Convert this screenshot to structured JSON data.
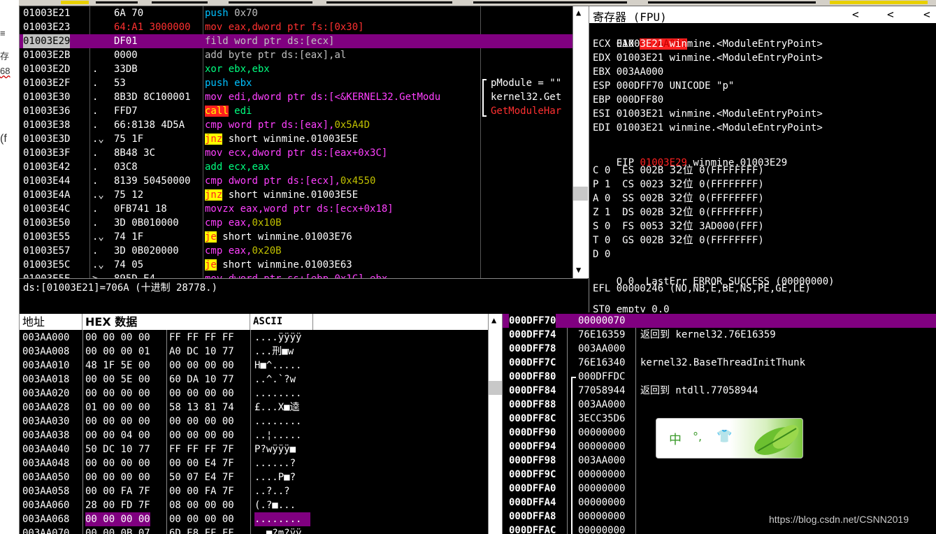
{
  "left_strip": {
    "chars": [
      "≡",
      "存",
      "68",
      "(f"
    ]
  },
  "disasm": {
    "rows": [
      {
        "addr": "01003E21",
        "mark": "",
        "hex": "6A 70",
        "mn": "push",
        "mn_class": "kw-push",
        "ops": " 0x70",
        "ops_class": "op-gray",
        "gray_line": true
      },
      {
        "addr": "01003E23",
        "mark": "",
        "hex": "64:A1 3000000",
        "mn": "mov",
        "mn_class": "op-red",
        "ops": " eax,dword ptr fs:[0x30]",
        "ops_class": "op-red",
        "hex_red": true
      },
      {
        "addr": "01003E29",
        "mark": "",
        "hex": "DF01",
        "mn": "fild",
        "mn_class": "op-gray",
        "ops": " word ptr ds:[ecx]",
        "ops_class": "op-gray",
        "selected": true
      },
      {
        "addr": "01003E2B",
        "mark": "",
        "hex": "0000",
        "mn": "add",
        "mn_class": "op-gray",
        "ops": " byte ptr ds:[eax],al",
        "ops_class": "op-gray"
      },
      {
        "addr": "01003E2D",
        "mark": ".",
        "hex": "33DB",
        "mn": "xor",
        "mn_class": "kw-xor",
        "ops": " ebx,ebx",
        "ops_class": "kw-xor"
      },
      {
        "addr": "01003E2F",
        "mark": ".",
        "hex": "53",
        "mn": "push",
        "mn_class": "kw-push",
        "ops": " ebx",
        "ops_class": "kw-push"
      },
      {
        "addr": "01003E30",
        "mark": ".",
        "hex": "8B3D 8C100001",
        "mn": "mov",
        "mn_class": "kw-mov",
        "ops": " edi,dword ptr ds:[<&KERNEL32.GetModu",
        "ops_class": "kw-mov"
      },
      {
        "addr": "01003E36",
        "mark": ".",
        "hex": "FFD7",
        "mn": "call",
        "mn_class": "kw-call",
        "ops": " edi",
        "ops_class": "kw-xor"
      },
      {
        "addr": "01003E38",
        "mark": ".",
        "hex": "66:8138 4D5A",
        "mn": "cmp",
        "mn_class": "kw-cmp",
        "ops": " word ptr ds:[eax],",
        "ops_class": "kw-cmp",
        "ops2": "0x5A4D",
        "ops2_class": "op-num"
      },
      {
        "addr": "01003E3D",
        "mark": ".⌄",
        "hex": "75 1F",
        "mn": "jnz",
        "mn_class": "kw-jmp",
        "ops": " short winmine.01003E5E",
        "ops_class": "op-white"
      },
      {
        "addr": "01003E3F",
        "mark": ".",
        "hex": "8B48 3C",
        "mn": "mov",
        "mn_class": "kw-mov",
        "ops": " ecx,dword ptr ds:[eax+0x3C]",
        "ops_class": "kw-mov"
      },
      {
        "addr": "01003E42",
        "mark": ".",
        "hex": "03C8",
        "mn": "add",
        "mn_class": "kw-add",
        "ops": " ecx,eax",
        "ops_class": "kw-add"
      },
      {
        "addr": "01003E44",
        "mark": ".",
        "hex": "8139 50450000",
        "mn": "cmp",
        "mn_class": "kw-cmp",
        "ops": " dword ptr ds:[ecx],",
        "ops_class": "kw-cmp",
        "ops2": "0x4550",
        "ops2_class": "op-num"
      },
      {
        "addr": "01003E4A",
        "mark": ".⌄",
        "hex": "75 12",
        "mn": "jnz",
        "mn_class": "kw-jmp",
        "ops": " short winmine.01003E5E",
        "ops_class": "op-white"
      },
      {
        "addr": "01003E4C",
        "mark": ".",
        "hex": "0FB741 18",
        "mn": "movzx",
        "mn_class": "kw-mov",
        "ops": " eax,word ptr ds:[ecx+0x18]",
        "ops_class": "kw-mov"
      },
      {
        "addr": "01003E50",
        "mark": ".",
        "hex": "3D 0B010000",
        "mn": "cmp",
        "mn_class": "kw-cmp",
        "ops": " eax,",
        "ops_class": "kw-cmp",
        "ops2": "0x10B",
        "ops2_class": "op-num"
      },
      {
        "addr": "01003E55",
        "mark": ".⌄",
        "hex": "74 1F",
        "mn": "je",
        "mn_class": "kw-jmp",
        "ops": " short winmine.01003E76",
        "ops_class": "op-white"
      },
      {
        "addr": "01003E57",
        "mark": ".",
        "hex": "3D 0B020000",
        "mn": "cmp",
        "mn_class": "kw-cmp",
        "ops": " eax,",
        "ops_class": "kw-cmp",
        "ops2": "0x20B",
        "ops2_class": "op-num"
      },
      {
        "addr": "01003E5C",
        "mark": ".⌄",
        "hex": "74 05",
        "mn": "je",
        "mn_class": "kw-jmp",
        "ops": " short winmine.01003E63",
        "ops_class": "op-white"
      },
      {
        "addr": "01003E5E",
        "mark": ">",
        "hex": "895D E4",
        "mn": "mov",
        "mn_class": "kw-mov",
        "ops": " dword ptr ss:[ebp-0x1C],ebx",
        "ops_class": "kw-mov"
      }
    ],
    "comments": [
      {
        "text": "pModule = \"\"",
        "color": "#ffffff"
      },
      {
        "text": "kernel32.Get",
        "color": "#ffffff"
      },
      {
        "text": "GetModuleHar",
        "color": "#ff3030"
      }
    ],
    "info_line": "ds:[01003E21]=706A (十进制 28778.)"
  },
  "registers": {
    "header": "寄存器 (FPU)",
    "header_arrows": [
      "<",
      "<",
      "<"
    ],
    "eax": {
      "name": "EAX",
      "value": "003AA000"
    },
    "gp": [
      {
        "name": "ECX",
        "value": "01003E21",
        "comment": "winmine.<ModuleEntryPoint>"
      },
      {
        "name": "EDX",
        "value": "01003E21",
        "comment": "winmine.<ModuleEntryPoint>"
      },
      {
        "name": "EBX",
        "value": "003AA000",
        "comment": ""
      },
      {
        "name": "ESP",
        "value": "000DFF70",
        "comment": "UNICODE \"p\""
      },
      {
        "name": "EBP",
        "value": "000DFF80",
        "comment": ""
      },
      {
        "name": "ESI",
        "value": "01003E21",
        "comment": "winmine.<ModuleEntryPoint>"
      },
      {
        "name": "EDI",
        "value": "01003E21",
        "comment": "winmine.<ModuleEntryPoint>"
      }
    ],
    "eip": {
      "name": "EIP",
      "value": "01003E29",
      "comment": "winmine.01003E29"
    },
    "flags": [
      {
        "flag": "C 0",
        "seg": "ES 002B",
        "bits": "32位",
        "base": "0(FFFFFFFF)"
      },
      {
        "flag": "P 1",
        "seg": "CS 0023",
        "bits": "32位",
        "base": "0(FFFFFFFF)"
      },
      {
        "flag": "A 0",
        "seg": "SS 002B",
        "bits": "32位",
        "base": "0(FFFFFFFF)"
      },
      {
        "flag": "Z 1",
        "seg": "DS 002B",
        "bits": "32位",
        "base": "0(FFFFFFFF)"
      },
      {
        "flag": "S 0",
        "seg": "FS 0053",
        "bits": "32位",
        "base": "3AD000(FFF)"
      },
      {
        "flag": "T 0",
        "seg": "GS 002B",
        "bits": "32位",
        "base": "0(FFFFFFFF)"
      },
      {
        "flag": "D 0",
        "seg": "",
        "bits": "",
        "base": ""
      }
    ],
    "lasterr": {
      "flag": "O 0",
      "text": "LastErr ERROR_SUCCESS (00000000)"
    },
    "efl": "EFL 00000246 (NO,NB,E,BE,NS,PE,GE,LE)",
    "st0": "ST0 empty 0.0"
  },
  "dump": {
    "headers": [
      "地址",
      "HEX 数据",
      "ASCII"
    ],
    "rows": [
      {
        "addr": "003AA000",
        "hex1": "00 00 00 00",
        "hex2": "FF FF FF FF",
        "ascii": "....ÿÿÿÿ"
      },
      {
        "addr": "003AA008",
        "hex1": "00 00 00 01",
        "hex2": "A0 DC 10 77",
        "ascii": "...刑■w"
      },
      {
        "addr": "003AA010",
        "hex1": "48 1F 5E 00",
        "hex2": "00 00 00 00",
        "ascii": "H■^....."
      },
      {
        "addr": "003AA018",
        "hex1": "00 00 5E 00",
        "hex2": "60 DA 10 77",
        "ascii": "..^.`?w"
      },
      {
        "addr": "003AA020",
        "hex1": "00 00 00 00",
        "hex2": "00 00 00 00",
        "ascii": "........"
      },
      {
        "addr": "003AA028",
        "hex1": "01 00 00 00",
        "hex2": "58 13 81 74",
        "ascii": "£...X■逵"
      },
      {
        "addr": "003AA030",
        "hex1": "00 00 00 00",
        "hex2": "00 00 00 00",
        "ascii": "........"
      },
      {
        "addr": "003AA038",
        "hex1": "00 00 04 00",
        "hex2": "00 00 00 00",
        "ascii": "..¦....."
      },
      {
        "addr": "003AA040",
        "hex1": "50 DC 10 77",
        "hex2": "FF FF FF 7F",
        "ascii": "P?wÿÿÿ■"
      },
      {
        "addr": "003AA048",
        "hex1": "00 00 00 00",
        "hex2": "00 00 E4 7F",
        "ascii": "......?"
      },
      {
        "addr": "003AA050",
        "hex1": "00 00 00 00",
        "hex2": "50 07 E4 7F",
        "ascii": "....P■?"
      },
      {
        "addr": "003AA058",
        "hex1": "00 00 FA 7F",
        "hex2": "00 00 FA 7F",
        "ascii": "..?..?"
      },
      {
        "addr": "003AA060",
        "hex1": "28 00 FD 7F",
        "hex2": "08 00 00 00",
        "ascii": "(.?■..."
      },
      {
        "addr": "003AA068",
        "hex1": "00 00 00 00",
        "hex2": "00 00 00 00",
        "ascii": "........",
        "hl": true
      },
      {
        "addr": "003AA070",
        "hex1": "00 00 0B 07",
        "hex2": "6D E8 FF FF",
        "ascii": "..■?m?ÿÿ"
      }
    ]
  },
  "stack": {
    "rows": [
      {
        "addr": "000DFF70",
        "val": "00000070",
        "comment": "",
        "selected": true
      },
      {
        "addr": "000DFF74",
        "val": "76E16359",
        "comment": "返回到 kernel32.76E16359"
      },
      {
        "addr": "000DFF78",
        "val": "003AA000",
        "comment": ""
      },
      {
        "addr": "000DFF7C",
        "val": "76E16340",
        "comment": "kernel32.BaseThreadInitThunk"
      },
      {
        "addr": "000DFF80",
        "val": "000DFFDC",
        "comment": "",
        "frame_start": true
      },
      {
        "addr": "000DFF84",
        "val": "77058944",
        "comment": "返回到 ntdll.77058944"
      },
      {
        "addr": "000DFF88",
        "val": "003AA000",
        "comment": ""
      },
      {
        "addr": "000DFF8C",
        "val": "3ECC35D6",
        "comment": ""
      },
      {
        "addr": "000DFF90",
        "val": "00000000",
        "comment": ""
      },
      {
        "addr": "000DFF94",
        "val": "00000000",
        "comment": ""
      },
      {
        "addr": "000DFF98",
        "val": "003AA000",
        "comment": ""
      },
      {
        "addr": "000DFF9C",
        "val": "00000000",
        "comment": ""
      },
      {
        "addr": "000DFFA0",
        "val": "00000000",
        "comment": ""
      },
      {
        "addr": "000DFFA4",
        "val": "00000000",
        "comment": ""
      },
      {
        "addr": "000DFFA8",
        "val": "00000000",
        "comment": ""
      },
      {
        "addr": "000DFFAC",
        "val": "00000000",
        "comment": ""
      }
    ]
  },
  "ime": {
    "lang": "中",
    "punct": "°,",
    "shirt_icon": "shirt-icon"
  },
  "watermark": "https://blog.csdn.net/CSNN2019",
  "colors": {
    "selected_row": "#800080",
    "eip_red": "#ff2020",
    "dump_highlight": "#800080"
  }
}
